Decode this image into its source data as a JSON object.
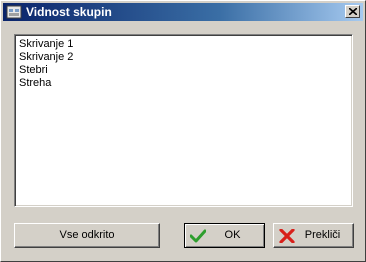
{
  "window": {
    "title": "Vidnost skupin",
    "icons": {
      "app": "dialog-app-icon",
      "close": "close-icon"
    }
  },
  "list": {
    "items": [
      "Skrivanje 1",
      "Skrivanje 2",
      "Stebri",
      "Streha"
    ]
  },
  "buttons": {
    "show_all": "Vse odkrito",
    "ok": "OK",
    "cancel": "Prekliči"
  },
  "colors": {
    "title_gradient_start": "#0a246a",
    "title_gradient_end": "#a6caf0",
    "ok_check": "#2e9e2e",
    "cancel_x": "#d8201a"
  }
}
